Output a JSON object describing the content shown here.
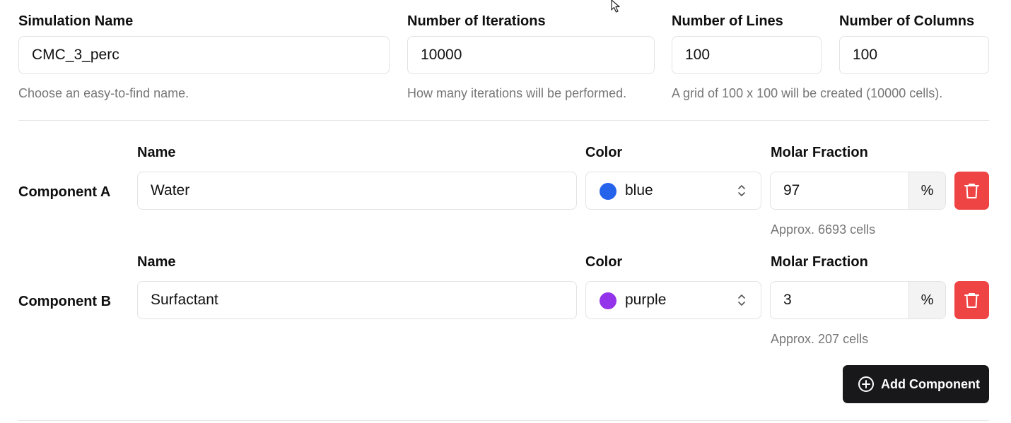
{
  "simulation": {
    "name_label": "Simulation Name",
    "name_value": "CMC_3_perc",
    "name_hint": "Choose an easy-to-find name.",
    "iterations_label": "Number of Iterations",
    "iterations_value": "10000",
    "iterations_hint": "How many iterations will be performed.",
    "lines_label": "Number of Lines",
    "lines_value": "100",
    "columns_label": "Number of Columns",
    "columns_value": "100",
    "grid_hint": "A grid of 100 x 100 will be created (10000 cells)."
  },
  "components": [
    {
      "title": "Component A",
      "name_label": "Name",
      "name_value": "Water",
      "color_label": "Color",
      "color_value": "blue",
      "color_hex": "#2563eb",
      "fraction_label": "Molar Fraction",
      "fraction_value": "97",
      "fraction_unit": "%",
      "cells_hint": "Approx. 6693 cells"
    },
    {
      "title": "Component B",
      "name_label": "Name",
      "name_value": "Surfactant",
      "color_label": "Color",
      "color_value": "purple",
      "color_hex": "#9333ea",
      "fraction_label": "Molar Fraction",
      "fraction_value": "3",
      "fraction_unit": "%",
      "cells_hint": "Approx. 207 cells"
    }
  ],
  "actions": {
    "add_component_label": "Add Component"
  },
  "colors": {
    "delete_button": "#ef4444",
    "primary_button": "#18181b"
  },
  "icons": {
    "delete": "trash-icon",
    "add": "plus-circle-icon",
    "select": "chevron-up-down-icon",
    "cursor": "mouse-cursor-icon"
  }
}
